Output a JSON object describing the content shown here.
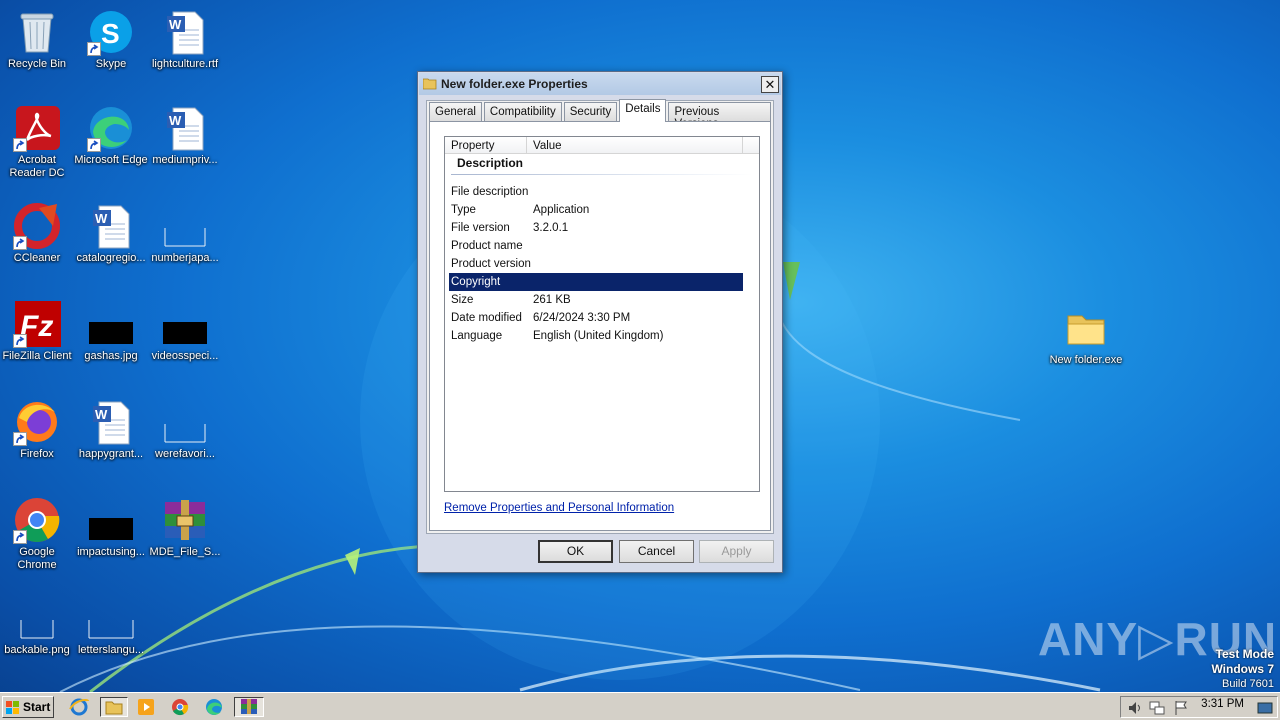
{
  "desktop": {
    "icons": [
      {
        "name": "recycle-bin",
        "label": "Recycle Bin"
      },
      {
        "name": "skype",
        "label": "Skype"
      },
      {
        "name": "lightculture",
        "label": "lightculture.rtf"
      },
      {
        "name": "acrobat",
        "label": "Acrobat Reader DC"
      },
      {
        "name": "edge",
        "label": "Microsoft Edge"
      },
      {
        "name": "mediumpriv",
        "label": "mediumpriv..."
      },
      {
        "name": "ccleaner",
        "label": "CCleaner"
      },
      {
        "name": "catalogregio",
        "label": "catalogregio..."
      },
      {
        "name": "numberjapa",
        "label": "numberjapa..."
      },
      {
        "name": "filezilla",
        "label": "FileZilla Client"
      },
      {
        "name": "gashas",
        "label": "gashas.jpg"
      },
      {
        "name": "videosspeci",
        "label": "videosspeci..."
      },
      {
        "name": "firefox",
        "label": "Firefox"
      },
      {
        "name": "happygrant",
        "label": "happygrant..."
      },
      {
        "name": "werefavori",
        "label": "werefavori..."
      },
      {
        "name": "chrome",
        "label": "Google Chrome"
      },
      {
        "name": "impactusing",
        "label": "impactusing..."
      },
      {
        "name": "mde-file",
        "label": "MDE_File_S..."
      },
      {
        "name": "backable",
        "label": "backable.png"
      },
      {
        "name": "letterslangu",
        "label": "letterslangu..."
      },
      {
        "name": "new-folder-exe",
        "label": "New folder.exe"
      }
    ]
  },
  "dialog": {
    "title": "New folder.exe Properties",
    "tabs": [
      "General",
      "Compatibility",
      "Security",
      "Details",
      "Previous Versions"
    ],
    "active_tab": "Details",
    "columns": [
      "Property",
      "Value"
    ],
    "group": "Description",
    "rows": [
      {
        "k": "File description",
        "v": ""
      },
      {
        "k": "Type",
        "v": "Application"
      },
      {
        "k": "File version",
        "v": "3.2.0.1"
      },
      {
        "k": "Product name",
        "v": ""
      },
      {
        "k": "Product version",
        "v": ""
      },
      {
        "k": "Copyright",
        "v": ""
      },
      {
        "k": "Size",
        "v": "261 KB"
      },
      {
        "k": "Date modified",
        "v": "6/24/2024 3:30 PM"
      },
      {
        "k": "Language",
        "v": "English (United Kingdom)"
      }
    ],
    "selected_row": "Copyright",
    "link": "Remove Properties and Personal Information",
    "buttons": {
      "ok": "OK",
      "cancel": "Cancel",
      "apply": "Apply"
    }
  },
  "taskbar": {
    "start": "Start",
    "clock": "3:31 PM"
  },
  "watermark": {
    "line1": "Test Mode",
    "line2": "Windows 7",
    "line3": "Build 7601",
    "brand": "ANY.RUN"
  }
}
